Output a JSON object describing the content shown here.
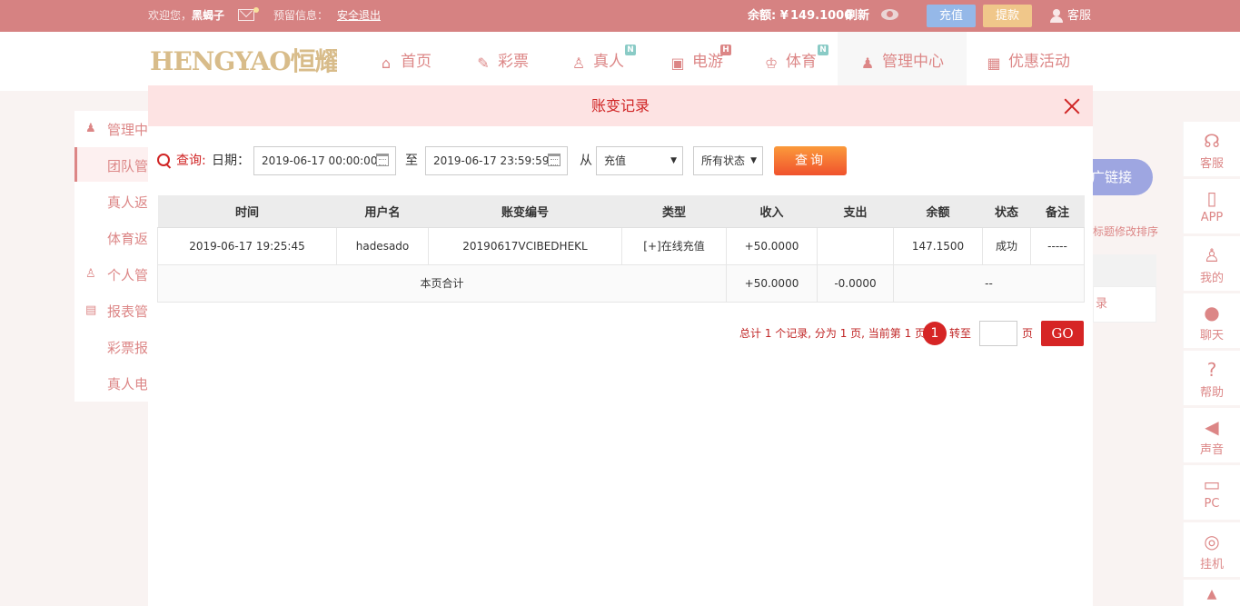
{
  "topbar": {
    "welcome": "欢迎您，",
    "username": "黑蝎子",
    "reserved_info": "预留信息：",
    "logout": "安全退出",
    "balance_label": "余额: ¥",
    "balance_value": "149.1000",
    "refresh": "刷新",
    "deposit": "充值",
    "withdraw": "提款",
    "service": "客服"
  },
  "nav": {
    "logo": "HENGYAO恒耀",
    "items": [
      {
        "label": "首页",
        "icon": "home-icon"
      },
      {
        "label": "彩票",
        "icon": "ticket-icon"
      },
      {
        "label": "真人",
        "icon": "live-dealer-icon",
        "badge": "N"
      },
      {
        "label": "电游",
        "icon": "slot-icon",
        "badge": "H"
      },
      {
        "label": "体育",
        "icon": "trophy-icon",
        "badge": "N"
      },
      {
        "label": "管理中心",
        "icon": "users-icon"
      },
      {
        "label": "优惠活动",
        "icon": "gift-icon"
      }
    ]
  },
  "background": {
    "left_menu": [
      "管理中心",
      "团队管理",
      "真人返水",
      "体育返水",
      "个人管理",
      "报表管理",
      "彩票报表",
      "真人电游"
    ],
    "promo_btn": "广链接",
    "note": "标题修改排序",
    "panel_text": "录"
  },
  "rightbar": [
    {
      "label": "客服",
      "icon": "headset-icon"
    },
    {
      "label": "APP",
      "icon": "phone-icon"
    },
    {
      "label": "我的",
      "icon": "user-icon"
    },
    {
      "label": "聊天",
      "icon": "chat-icon"
    },
    {
      "label": "帮助",
      "icon": "help-icon"
    },
    {
      "label": "声音",
      "icon": "speaker-icon"
    },
    {
      "label": "PC",
      "icon": "monitor-icon"
    },
    {
      "label": "挂机",
      "icon": "robot-icon"
    }
  ],
  "modal": {
    "title": "账变记录",
    "query_label": "查询:",
    "date_label": "日期：",
    "date_from": "2019-06-17 00:00:00",
    "to_label": "至",
    "date_to": "2019-06-17 23:59:59",
    "from_label": "从",
    "type_select": "充值",
    "status_select": "所有状态",
    "query_button": "查询",
    "table": {
      "headers": [
        "时间",
        "用户名",
        "账变编号",
        "类型",
        "收入",
        "支出",
        "余额",
        "状态",
        "备注"
      ],
      "rows": [
        [
          "2019-06-17 19:25:45",
          "hadesado",
          "20190617VCIBEDHEKL",
          "[+]在线充值",
          "+50.0000",
          "",
          "147.1500",
          "成功",
          "-----"
        ]
      ],
      "summary": {
        "label": "本页合计",
        "income": "+50.0000",
        "expense": "-0.0000",
        "rest": "--"
      }
    },
    "pagination": {
      "summary": "总计 1 个记录, 分为 1 页, 当前第 1 页",
      "current_page": "1",
      "goto_label": "转至",
      "page_unit": "页",
      "go_button": "GO"
    }
  }
}
